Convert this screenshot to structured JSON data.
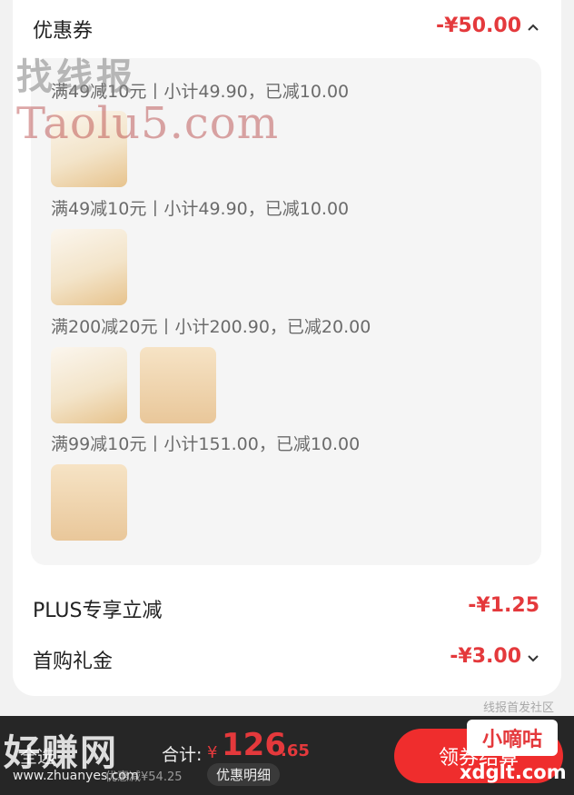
{
  "coupon_section": {
    "title": "优惠券",
    "amount": "-¥50.00",
    "chevron": "chevron-up-icon",
    "groups": [
      {
        "label": "满49减10元丨小计49.90，已减10.00",
        "products": [
          "bread-box"
        ]
      },
      {
        "label": "满49减10元丨小计49.90，已减10.00",
        "products": [
          "bread-box"
        ]
      },
      {
        "label": "满200减20元丨小计200.90，已减20.00",
        "products": [
          "bread-box",
          "pastry-pack"
        ]
      },
      {
        "label": "满99减10元丨小计151.00，已减10.00",
        "products": [
          "pastry-pack"
        ]
      }
    ]
  },
  "plus_row": {
    "title": "PLUS专享立减",
    "amount": "-¥1.25"
  },
  "first_buy_row": {
    "title": "首购礼金",
    "amount": "-¥3.00",
    "chevron": "chevron-down-icon"
  },
  "watermarks": {
    "top": "找线报",
    "url": "Taolu5.com",
    "corner": "线报首发社区",
    "bottom_left": "好赚网",
    "bottom_left_url": "www.zhuanyes.com",
    "bottom_right": "小嘀咕",
    "bottom_right_url": "xdglt.com"
  },
  "bottom_bar": {
    "select_all": "全选",
    "total_label": "合计:",
    "currency": "¥",
    "price_int": "126",
    "price_dec": ".65",
    "saved_text": "优惠减¥54.25",
    "detail_button": "优惠明细",
    "checkout_button": "领券结算"
  },
  "colors": {
    "accent": "#e4393c",
    "bar_bg": "#262626",
    "button": "#ef2d2d"
  }
}
